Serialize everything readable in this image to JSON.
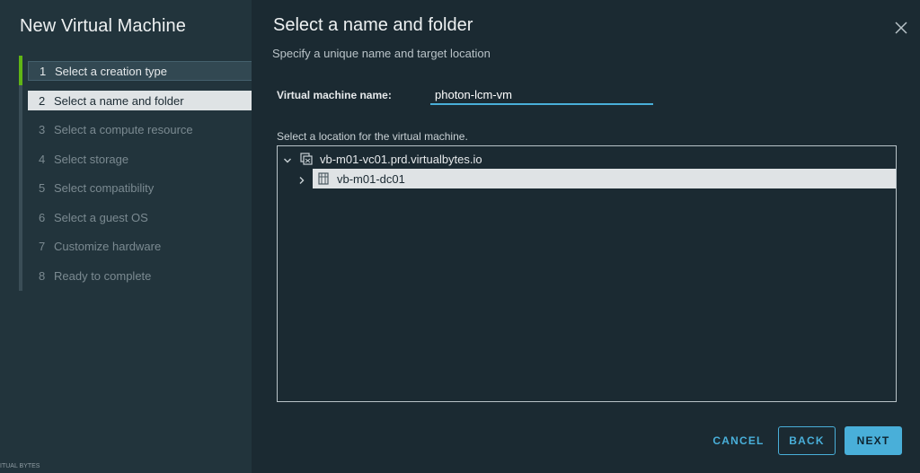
{
  "wizard": {
    "title": "New Virtual Machine",
    "steps": [
      {
        "num": "1",
        "label": "Select a creation type",
        "state": "done"
      },
      {
        "num": "2",
        "label": "Select a name and folder",
        "state": "current"
      },
      {
        "num": "3",
        "label": "Select a compute resource",
        "state": "pending"
      },
      {
        "num": "4",
        "label": "Select storage",
        "state": "pending"
      },
      {
        "num": "5",
        "label": "Select compatibility",
        "state": "pending"
      },
      {
        "num": "6",
        "label": "Select a guest OS",
        "state": "pending"
      },
      {
        "num": "7",
        "label": "Customize hardware",
        "state": "pending"
      },
      {
        "num": "8",
        "label": "Ready to complete",
        "state": "pending"
      }
    ]
  },
  "page": {
    "title": "Select a name and folder",
    "subtitle": "Specify a unique name and target location"
  },
  "form": {
    "name_label": "Virtual machine name:",
    "name_value": "photon-lcm-vm",
    "location_label": "Select a location for the virtual machine."
  },
  "tree": {
    "vcenter": {
      "label": "vb-m01-vc01.prd.virtualbytes.io",
      "icon": "vcenter-icon",
      "expanded": true
    },
    "datacenter": {
      "label": "vb-m01-dc01",
      "icon": "datacenter-icon",
      "expanded": false,
      "selected": true
    }
  },
  "footer": {
    "cancel_label": "CANCEL",
    "back_label": "BACK",
    "next_label": "NEXT"
  },
  "corner_text": "ITUAL BYTES",
  "colors": {
    "accent": "#49afd9",
    "progress": "#60b515",
    "sidebar_bg": "#22343c",
    "main_bg": "#1b2a32"
  }
}
